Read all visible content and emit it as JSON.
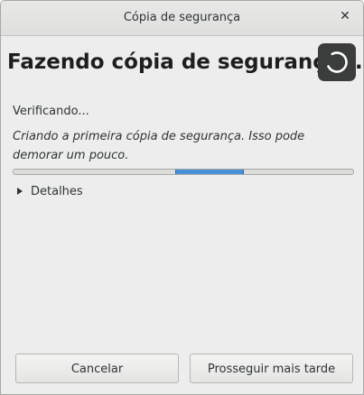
{
  "window": {
    "title": "Cópia de segurança",
    "close_glyph": "✕"
  },
  "main": {
    "heading": "Fazendo cópia de segurança...",
    "status": "Verificando...",
    "detail": "Criando a primeira cópia de segurança. Isso pode demorar um pouco.",
    "progress": {
      "indeterminate": true,
      "pulse_start_fraction": 0.477,
      "pulse_width_fraction": 0.198,
      "fill_color": "#4a90d9"
    },
    "details_expander": {
      "label": "Detalhes",
      "expanded": false
    },
    "spinner_icon": "spinner-icon"
  },
  "buttons": {
    "cancel": "Cancelar",
    "resume_later": "Prosseguir mais tarde"
  },
  "colors": {
    "background": "#ededed",
    "text": "#2e3436",
    "accent": "#4a90d9",
    "spinner_bg": "#3b3d3c"
  }
}
